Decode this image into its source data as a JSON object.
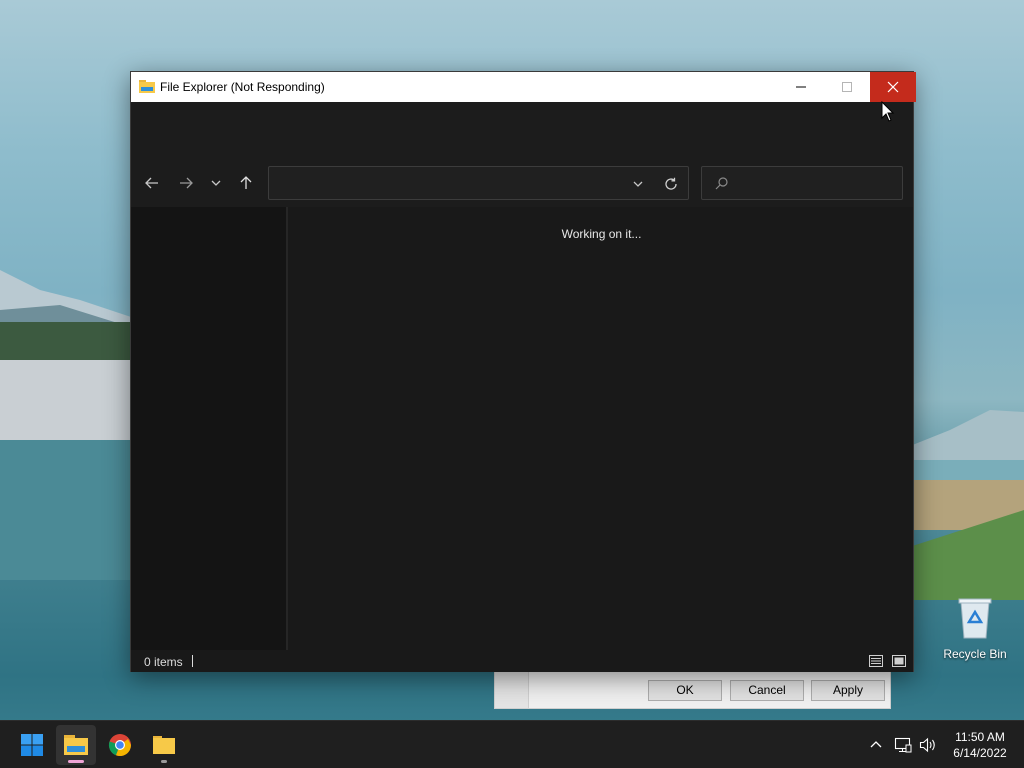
{
  "window": {
    "title": "File Explorer (Not Responding)"
  },
  "address_bar": {
    "value": "",
    "placeholder": ""
  },
  "search_box": {
    "value": "",
    "placeholder": ""
  },
  "content": {
    "status_message": "Working on it..."
  },
  "status_bar": {
    "item_count": "0 items"
  },
  "dialog": {
    "ok_label": "OK",
    "cancel_label": "Cancel",
    "apply_label": "Apply"
  },
  "desktop": {
    "recycle_bin_label": "Recycle Bin"
  },
  "taskbar": {
    "items": [
      "start-icon",
      "file-explorer-icon",
      "chrome-icon",
      "folder-icon"
    ],
    "clock_time": "11:50 AM",
    "clock_date": "6/14/2022"
  },
  "colors": {
    "close_red": "#c42b1c",
    "explorer_bg": "#191919",
    "accent_blue": "#0078d4"
  }
}
